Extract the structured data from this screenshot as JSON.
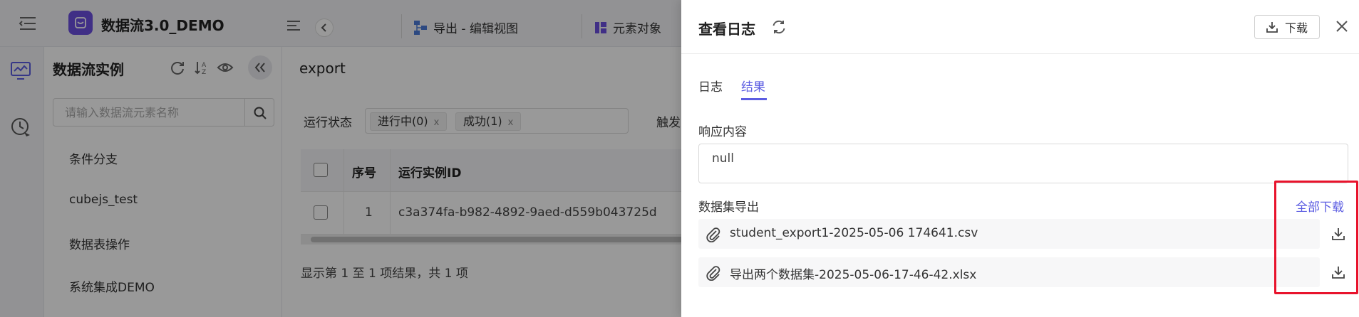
{
  "app": {
    "title": "数据流3.0_DEMO",
    "tabs": [
      {
        "label": "导出 - 编辑视图",
        "icon": "flow-icon"
      },
      {
        "label": "元素对象",
        "icon": "grid-icon"
      }
    ]
  },
  "sidebar": {
    "title": "数据流实例",
    "search_placeholder": "请输入数据流元素名称",
    "items": [
      "条件分支",
      "cubejs_test",
      "数据表操作",
      "系统集成DEMO"
    ]
  },
  "main": {
    "title": "export",
    "status_label": "运行状态",
    "status_chips": [
      "进行中(0)",
      "成功(1)"
    ],
    "chip_close": "x",
    "trigger_label": "触发",
    "table": {
      "headers": [
        "序号",
        "运行实例ID"
      ],
      "rows": [
        {
          "index": "1",
          "instance_id": "c3a374fa-b982-4892-9aed-d559b043725d"
        }
      ]
    },
    "pager_text": "显示第 1 至 1 项结果，共 1 项"
  },
  "drawer": {
    "title": "查看日志",
    "download_label": "下载",
    "tabs": [
      {
        "label": "日志",
        "active": false
      },
      {
        "label": "结果",
        "active": true
      }
    ],
    "response_label": "响应内容",
    "response_value": "null",
    "dataset_label": "数据集导出",
    "download_all_label": "全部下载",
    "files": [
      "student_export1-2025-05-06 174641.csv",
      "导出两个数据集-2025-05-06-17-46-42.xlsx"
    ]
  },
  "colors": {
    "accent": "#5b5ce2",
    "brand": "#6b4fe0",
    "highlight": "#e8132c"
  }
}
